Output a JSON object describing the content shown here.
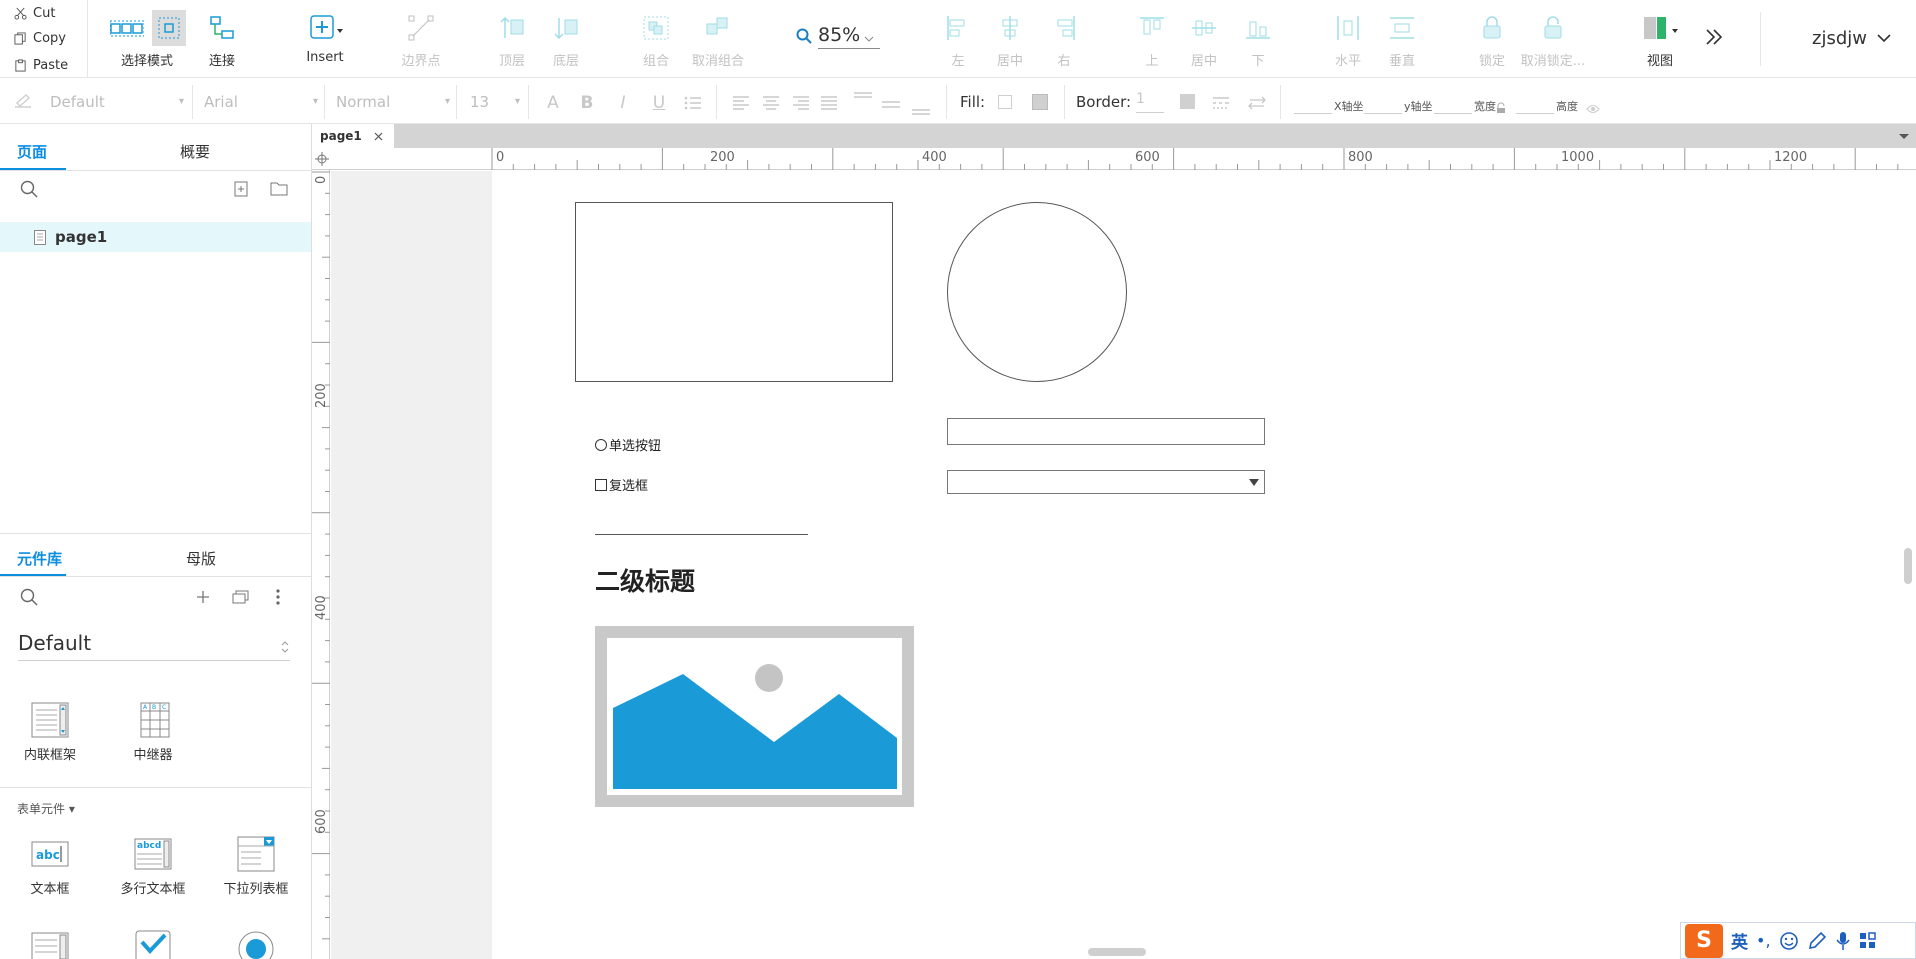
{
  "clipboard": {
    "cut": "Cut",
    "copy": "Copy",
    "paste": "Paste"
  },
  "toolbar": {
    "select_mode": "选择模式",
    "connect": "连接",
    "insert": "Insert",
    "boundary_point": "边界点",
    "top_layer": "顶层",
    "bottom_layer": "底层",
    "group": "组合",
    "ungroup": "取消组合",
    "zoom": "85%",
    "align_left": "左",
    "align_center": "居中",
    "align_right": "右",
    "align_top": "上",
    "align_middle": "居中",
    "align_bottom": "下",
    "distribute_h": "水平",
    "distribute_v": "垂直",
    "lock": "锁定",
    "unlock": "取消锁定...",
    "view": "视图",
    "user": "zjsdjw"
  },
  "formatbar": {
    "style": "Default",
    "font": "Arial",
    "weight": "Normal",
    "size": "13",
    "fill_label": "Fill:",
    "border_label": "Border:",
    "border_value": "1",
    "x_label": "X轴坐",
    "y_label": "y轴坐",
    "width_label": "宽度",
    "height_label": "高度"
  },
  "left_panel": {
    "tab_pages": "页面",
    "tab_outline": "概要",
    "page_item": "page1",
    "tab_library": "元件库",
    "tab_masters": "母版",
    "library_name": "Default",
    "library_items_row1": [
      "内联框架",
      "中继器"
    ],
    "section_form": "表单元件 ▾",
    "library_items_row2": [
      "文本框",
      "多行文本框",
      "下拉列表框"
    ]
  },
  "document": {
    "tab_name": "page1"
  },
  "rulers": {
    "top": [
      "0",
      "200",
      "400",
      "600",
      "800",
      "1000",
      "1200"
    ],
    "left": [
      "0",
      "200",
      "400",
      "600"
    ]
  },
  "canvas": {
    "radio_label": "单选按钮",
    "checkbox_label": "复选框",
    "heading": "二级标题"
  },
  "ime": {
    "lang": "英"
  },
  "colors": {
    "accent": "#0e8ee0",
    "image_placeholder": "#1a9bd7",
    "toolbar_icon": "#5cc8d6"
  }
}
